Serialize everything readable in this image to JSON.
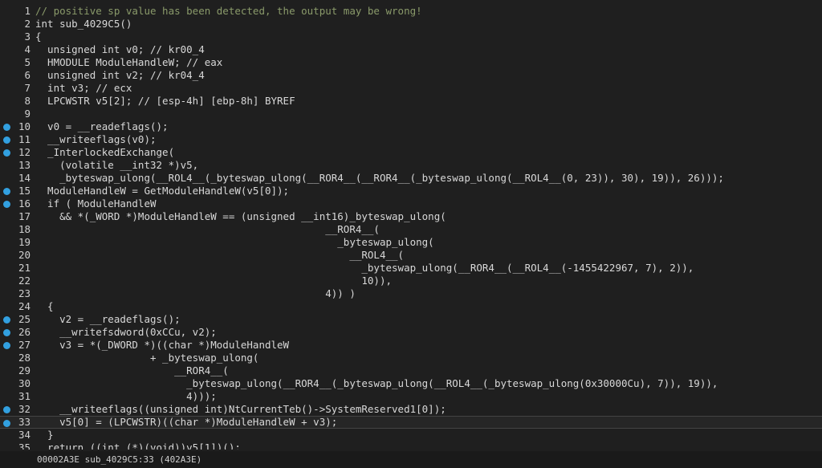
{
  "lines": [
    {
      "n": "1",
      "bp": false,
      "text": "// positive sp value has been detected, the output may be wrong!",
      "cls": "c-comment"
    },
    {
      "n": "2",
      "bp": false,
      "text": "int sub_4029C5()",
      "cls": "c-id"
    },
    {
      "n": "3",
      "bp": false,
      "text": "{",
      "cls": "c-id"
    },
    {
      "n": "4",
      "bp": false,
      "text": "  unsigned int v0; // kr00_4",
      "cls": "c-id"
    },
    {
      "n": "5",
      "bp": false,
      "text": "  HMODULE ModuleHandleW; // eax",
      "cls": "c-id"
    },
    {
      "n": "6",
      "bp": false,
      "text": "  unsigned int v2; // kr04_4",
      "cls": "c-id"
    },
    {
      "n": "7",
      "bp": false,
      "text": "  int v3; // ecx",
      "cls": "c-id"
    },
    {
      "n": "8",
      "bp": false,
      "text": "  LPCWSTR v5[2]; // [esp-4h] [ebp-8h] BYREF",
      "cls": "c-id"
    },
    {
      "n": "9",
      "bp": false,
      "text": "",
      "cls": "c-id"
    },
    {
      "n": "10",
      "bp": true,
      "text": "  v0 = __readeflags();",
      "cls": "c-id"
    },
    {
      "n": "11",
      "bp": true,
      "text": "  __writeeflags(v0);",
      "cls": "c-id"
    },
    {
      "n": "12",
      "bp": true,
      "text": "  _InterlockedExchange(",
      "cls": "c-id"
    },
    {
      "n": "13",
      "bp": false,
      "text": "    (volatile __int32 *)v5,",
      "cls": "c-id"
    },
    {
      "n": "14",
      "bp": false,
      "text": "    _byteswap_ulong(__ROL4__(_byteswap_ulong(__ROR4__(__ROR4__(_byteswap_ulong(__ROL4__(0, 23)), 30), 19)), 26)));",
      "cls": "c-id"
    },
    {
      "n": "15",
      "bp": true,
      "text": "  ModuleHandleW = GetModuleHandleW(v5[0]);",
      "cls": "c-id"
    },
    {
      "n": "16",
      "bp": true,
      "text": "  if ( ModuleHandleW",
      "cls": "c-id"
    },
    {
      "n": "17",
      "bp": false,
      "text": "    && *(_WORD *)ModuleHandleW == (unsigned __int16)_byteswap_ulong(",
      "cls": "c-id"
    },
    {
      "n": "18",
      "bp": false,
      "text": "                                                __ROR4__(",
      "cls": "c-id"
    },
    {
      "n": "19",
      "bp": false,
      "text": "                                                  _byteswap_ulong(",
      "cls": "c-id"
    },
    {
      "n": "20",
      "bp": false,
      "text": "                                                    __ROL4__(",
      "cls": "c-id"
    },
    {
      "n": "21",
      "bp": false,
      "text": "                                                      _byteswap_ulong(__ROR4__(__ROL4__(-1455422967, 7), 2)),",
      "cls": "c-id"
    },
    {
      "n": "22",
      "bp": false,
      "text": "                                                      10)),",
      "cls": "c-id"
    },
    {
      "n": "23",
      "bp": false,
      "text": "                                                4)) )",
      "cls": "c-id"
    },
    {
      "n": "24",
      "bp": false,
      "text": "  {",
      "cls": "c-id"
    },
    {
      "n": "25",
      "bp": true,
      "text": "    v2 = __readeflags();",
      "cls": "c-id"
    },
    {
      "n": "26",
      "bp": true,
      "text": "    __writefsdword(0xCCu, v2);",
      "cls": "c-id"
    },
    {
      "n": "27",
      "bp": true,
      "text": "    v3 = *(_DWORD *)((char *)ModuleHandleW",
      "cls": "c-id"
    },
    {
      "n": "28",
      "bp": false,
      "text": "                   + _byteswap_ulong(",
      "cls": "c-id"
    },
    {
      "n": "29",
      "bp": false,
      "text": "                       __ROR4__(",
      "cls": "c-id"
    },
    {
      "n": "30",
      "bp": false,
      "text": "                         _byteswap_ulong(__ROR4__(_byteswap_ulong(__ROL4__(_byteswap_ulong(0x30000Cu), 7)), 19)),",
      "cls": "c-id"
    },
    {
      "n": "31",
      "bp": false,
      "text": "                         4)));",
      "cls": "c-id"
    },
    {
      "n": "32",
      "bp": true,
      "text": "    __writeeflags((unsigned int)NtCurrentTeb()->SystemReserved1[0]);",
      "cls": "c-id"
    },
    {
      "n": "33",
      "bp": true,
      "text": "    v5[0] = (LPCWSTR)((char *)ModuleHandleW + v3);",
      "cls": "c-id",
      "current": true
    },
    {
      "n": "34",
      "bp": false,
      "text": "  }",
      "cls": "c-id"
    },
    {
      "n": "35",
      "bp": false,
      "text": "  return ((int (*)(void))v5[1])();",
      "cls": "c-id"
    }
  ],
  "statusbar": {
    "text": "00002A3E sub_4029C5:33 (402A3E)"
  },
  "colors": {
    "breakpoint": "#32a0e0",
    "background": "#1f1f1f",
    "comment": "#8a9a6a"
  }
}
